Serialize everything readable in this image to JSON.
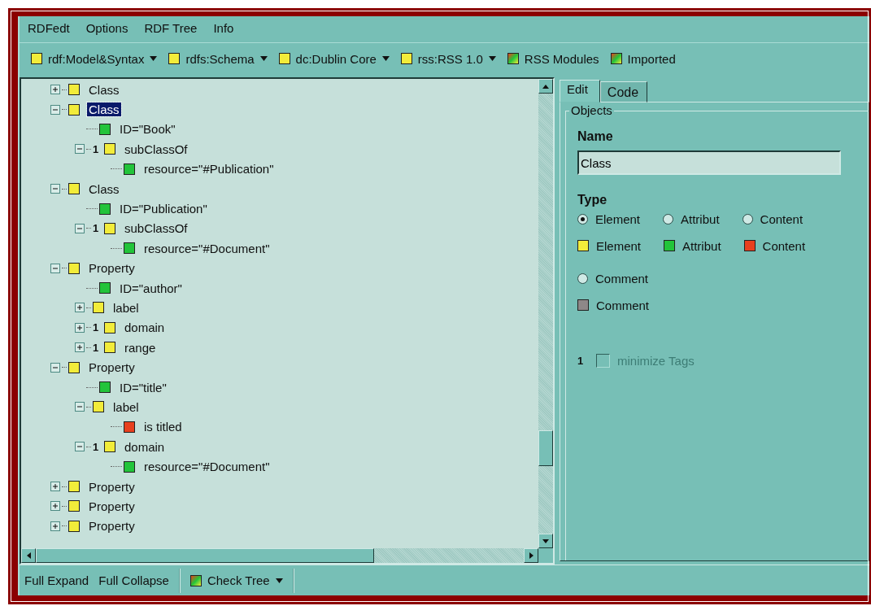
{
  "menu": [
    "RDFedt",
    "Options",
    "RDF Tree",
    "Info"
  ],
  "toolbar": [
    {
      "label": "rdf:Model&Syntax",
      "kind": "element",
      "has_menu": true
    },
    {
      "label": "rdfs:Schema",
      "kind": "element",
      "has_menu": true
    },
    {
      "label": "dc:Dublin Core",
      "kind": "element",
      "has_menu": true
    },
    {
      "label": "rss:RSS 1.0",
      "kind": "element",
      "has_menu": true
    },
    {
      "label": "RSS Modules",
      "kind": "mixed",
      "has_menu": false
    },
    {
      "label": "Imported",
      "kind": "mixed",
      "has_menu": false
    }
  ],
  "tree": {
    "items": [
      {
        "label": "Class",
        "kind": "element",
        "expanded": false,
        "selected": false
      },
      {
        "label": "Class",
        "kind": "element",
        "expanded": true,
        "selected": true,
        "children": [
          {
            "label": "ID=\"Book\"",
            "kind": "attribute",
            "selected": false
          },
          {
            "label": "subClassOf",
            "kind": "element",
            "cardinality": "1",
            "expanded": true,
            "selected": false,
            "children": [
              {
                "label": "resource=\"#Publication\"",
                "kind": "attribute",
                "selected": false
              }
            ]
          }
        ]
      },
      {
        "label": "Class",
        "kind": "element",
        "expanded": true,
        "selected": false,
        "children": [
          {
            "label": "ID=\"Publication\"",
            "kind": "attribute",
            "selected": false
          },
          {
            "label": "subClassOf",
            "kind": "element",
            "cardinality": "1",
            "expanded": true,
            "selected": false,
            "children": [
              {
                "label": "resource=\"#Document\"",
                "kind": "attribute",
                "selected": false
              }
            ]
          }
        ]
      },
      {
        "label": "Property",
        "kind": "element",
        "expanded": true,
        "selected": false,
        "children": [
          {
            "label": "ID=\"author\"",
            "kind": "attribute",
            "selected": false
          },
          {
            "label": "label",
            "kind": "element",
            "expanded": false,
            "selected": false
          },
          {
            "label": "domain",
            "kind": "element",
            "cardinality": "1",
            "expanded": false,
            "selected": false
          },
          {
            "label": "range",
            "kind": "element",
            "cardinality": "1",
            "expanded": false,
            "selected": false
          }
        ]
      },
      {
        "label": "Property",
        "kind": "element",
        "expanded": true,
        "selected": false,
        "children": [
          {
            "label": "ID=\"title\"",
            "kind": "attribute",
            "selected": false
          },
          {
            "label": "label",
            "kind": "element",
            "expanded": true,
            "selected": false,
            "children": [
              {
                "label": "is titled",
                "kind": "content",
                "selected": false
              }
            ]
          },
          {
            "label": "domain",
            "kind": "element",
            "cardinality": "1",
            "expanded": true,
            "selected": false,
            "children": [
              {
                "label": "resource=\"#Document\"",
                "kind": "attribute",
                "selected": false
              }
            ]
          }
        ]
      },
      {
        "label": "Property",
        "kind": "element",
        "expanded": false,
        "selected": false
      },
      {
        "label": "Property",
        "kind": "element",
        "expanded": false,
        "selected": false
      },
      {
        "label": "Property",
        "kind": "element",
        "expanded": false,
        "selected": false
      }
    ]
  },
  "tabs": [
    {
      "label": "Edit",
      "selected": true
    },
    {
      "label": "Code",
      "selected": false
    }
  ],
  "editor": {
    "group_title": "Objects",
    "name_label": "Name",
    "name_value": "Class",
    "type_label": "Type",
    "type_options": [
      {
        "label": "Element",
        "selected": true
      },
      {
        "label": "Attribut",
        "selected": false
      },
      {
        "label": "Content",
        "selected": false
      }
    ],
    "legend": [
      {
        "label": "Element",
        "kind": "element"
      },
      {
        "label": "Attribut",
        "kind": "attribute"
      },
      {
        "label": "Content",
        "kind": "content"
      }
    ],
    "comment_option": {
      "label": "Comment",
      "selected": false
    },
    "comment_legend": {
      "label": "Comment",
      "kind": "comment"
    },
    "minimize": {
      "cardinality": "1",
      "label": "minimize Tags",
      "checked": false,
      "disabled": true
    }
  },
  "bottom_bar": {
    "buttons": [
      "Full Expand",
      "Full Collapse"
    ],
    "check": {
      "label": "Check Tree",
      "kind": "mixed",
      "has_menu": true
    }
  }
}
